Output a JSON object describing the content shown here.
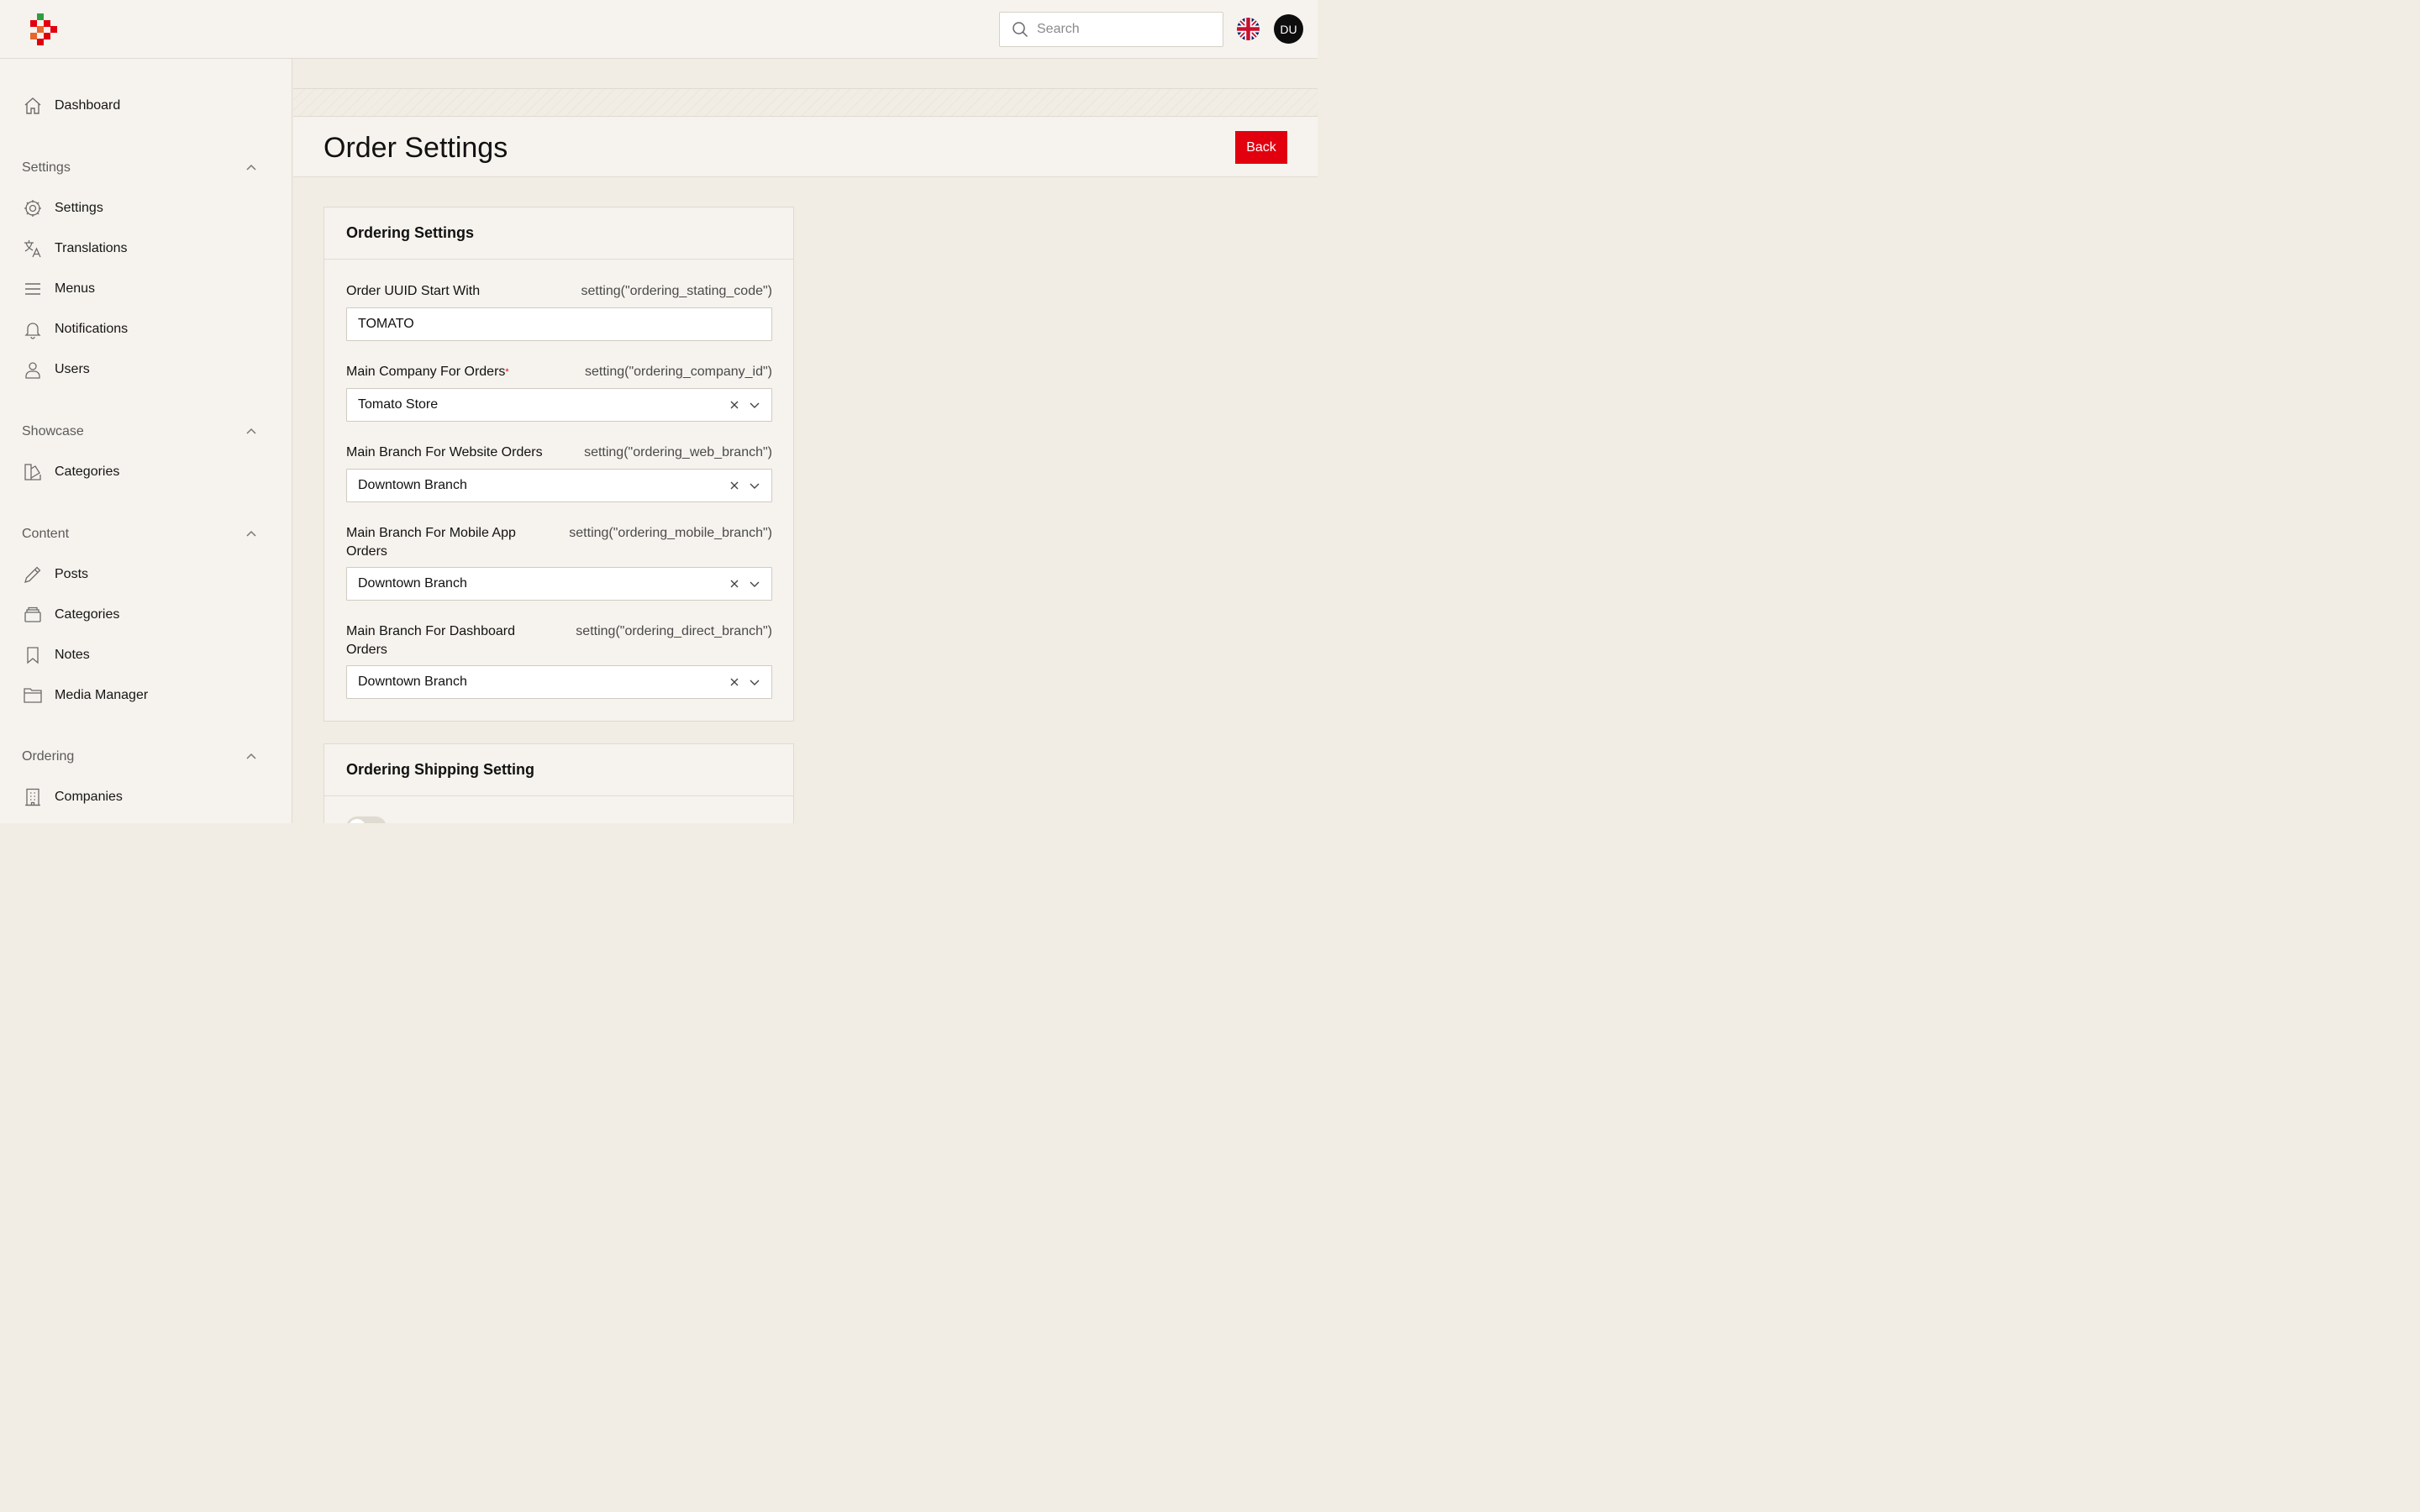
{
  "header": {
    "search_placeholder": "Search",
    "avatar_initials": "DU",
    "language_icon": "uk-flag-icon",
    "colors": {
      "accent": "#e2000f",
      "logo_green": "#2f9e3f",
      "logo_red": "#e2000f",
      "logo_orange": "#e8652b"
    }
  },
  "sidebar": {
    "dashboard": {
      "label": "Dashboard",
      "icon": "home-icon"
    },
    "groups": [
      {
        "label": "Settings",
        "items": [
          {
            "label": "Settings",
            "icon": "gear-icon"
          },
          {
            "label": "Translations",
            "icon": "translate-icon"
          },
          {
            "label": "Menus",
            "icon": "menu-icon"
          },
          {
            "label": "Notifications",
            "icon": "bell-icon"
          },
          {
            "label": "Users",
            "icon": "user-icon"
          }
        ]
      },
      {
        "label": "Showcase",
        "items": [
          {
            "label": "Categories",
            "icon": "swatch-icon"
          }
        ]
      },
      {
        "label": "Content",
        "items": [
          {
            "label": "Posts",
            "icon": "pencil-icon"
          },
          {
            "label": "Categories",
            "icon": "stack-icon"
          },
          {
            "label": "Notes",
            "icon": "bookmark-icon"
          },
          {
            "label": "Media Manager",
            "icon": "folder-icon"
          }
        ]
      },
      {
        "label": "Ordering",
        "items": [
          {
            "label": "Companies",
            "icon": "building-icon"
          }
        ]
      }
    ]
  },
  "page": {
    "title": "Order Settings",
    "back_label": "Back",
    "cards": [
      {
        "title": "Ordering Settings",
        "fields": [
          {
            "label": "Order UUID Start With",
            "key": "setting(\"ordering_stating_code\")",
            "value": "TOMATO",
            "type": "text",
            "required": false
          },
          {
            "label": "Main Company For Orders",
            "key": "setting(\"ordering_company_id\")",
            "value": "Tomato Store",
            "type": "select",
            "required": true
          },
          {
            "label": "Main Branch For Website Orders",
            "key": "setting(\"ordering_web_branch\")",
            "value": "Downtown Branch",
            "type": "select",
            "required": false
          },
          {
            "label": "Main Branch For Mobile App Orders",
            "key": "setting(\"ordering_mobile_branch\")",
            "value": "Downtown Branch",
            "type": "select",
            "required": false
          },
          {
            "label": "Main Branch For Dashboard Orders",
            "key": "setting(\"ordering_direct_branch\")",
            "value": "Downtown Branch",
            "type": "select",
            "required": false
          }
        ]
      },
      {
        "title": "Ordering Shipping Setting",
        "toggle_label": "",
        "toggle_on": false
      }
    ]
  }
}
